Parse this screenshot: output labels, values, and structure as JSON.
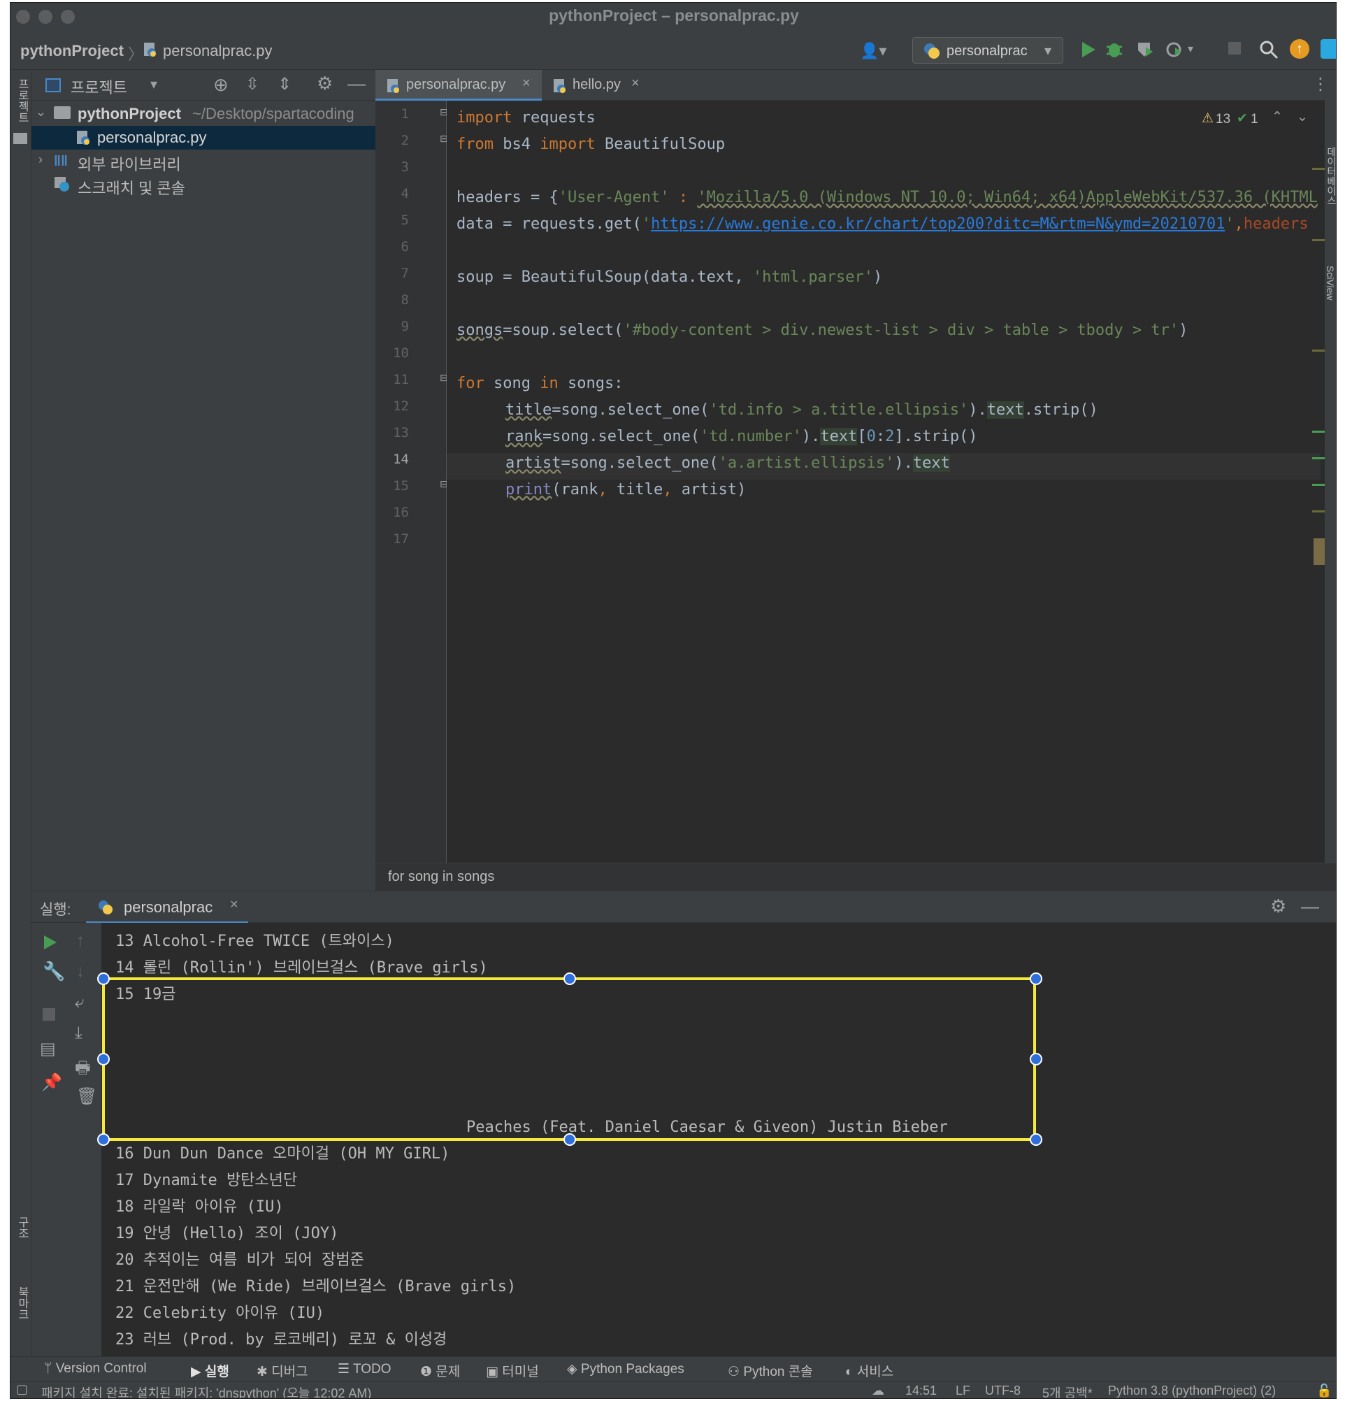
{
  "window": {
    "title": "pythonProject – personalprac.py"
  },
  "navbar": {
    "project": "pythonProject",
    "file": "personalprac.py",
    "run_config": "personalprac"
  },
  "project_panel": {
    "header": "프로젝트",
    "root_name": "pythonProject",
    "root_path": "~/Desktop/spartacoding",
    "file": "personalprac.py",
    "external_libs": "외부 라이브러리",
    "scratches": "스크래치 및 콘솔"
  },
  "editor": {
    "tabs": [
      {
        "label": "personalprac.py"
      },
      {
        "label": "hello.py"
      }
    ],
    "inspections": {
      "warnings": "13",
      "ok": "1"
    },
    "line_numbers": [
      "1",
      "2",
      "3",
      "4",
      "5",
      "6",
      "7",
      "8",
      "9",
      "10",
      "11",
      "12",
      "13",
      "14",
      "15",
      "16",
      "17"
    ],
    "current_line": "14",
    "code": {
      "l1_kw": "import",
      "l1_rest": " requests",
      "l2_kw1": "from",
      "l2_mod": " bs4 ",
      "l2_kw2": "import",
      "l2_rest": " BeautifulSoup",
      "l4_a": "headers = {",
      "l4_s1": "'User-Agent'",
      "l4_b": " : ",
      "l4_s2": "'Mozilla/5.0 (Windows NT 10.0; Win64; x64)AppleWebKit/537.36 (KHTML",
      "l5_a": "data = requests.get(",
      "l5_q1": "'",
      "l5_url": "https://www.genie.co.kr/chart/top200?ditc=M&rtm=N&ymd=20210701",
      "l5_q2": "'",
      "l5_b": ",",
      "l5_pm": "headers",
      "l7_a": "soup = BeautifulSoup(data.text, ",
      "l7_s": "'html.parser'",
      "l7_b": ")",
      "l9_a": "songs",
      "l9_b": "=soup.select(",
      "l9_s": "'#body-content > div.newest-list > div > table > tbody > tr'",
      "l9_c": ")",
      "l11_kw1": "for",
      "l11_a": " song ",
      "l11_kw2": "in",
      "l11_b": " songs:",
      "l12_a": "title",
      "l12_b": "=song.select_one(",
      "l12_s": "'td.info > a.title.ellipsis'",
      "l12_c": ").",
      "l12_h": "text",
      "l12_d": ".strip()",
      "l13_a": "rank",
      "l13_b": "=song.select_one(",
      "l13_s": "'td.number'",
      "l13_c": ").",
      "l13_h": "text",
      "l13_d": "[",
      "l13_n1": "0",
      "l13_e": ":",
      "l13_n2": "2",
      "l13_f": "].strip()",
      "l14_a": "artist",
      "l14_b": "=song.select_one(",
      "l14_s": "'a.artist.ellipsis'",
      "l14_c": ").",
      "l14_h": "text",
      "l15_bi": "print",
      "l15_a": "(rank",
      "l15_c1": ",",
      "l15_b": " title",
      "l15_c2": ",",
      "l15_d": " artist)"
    },
    "breadcrumb": "for song in songs"
  },
  "run_panel": {
    "label": "실행:",
    "tab": "personalprac",
    "output": [
      "13 Alcohol-Free TWICE (트와이스)",
      "14 롤린 (Rollin') 브레이브걸스 (Brave girls)",
      "15 19금",
      "Peaches (Feat. Daniel Caesar & Giveon) Justin Bieber",
      "16 Dun Dun Dance 오마이걸 (OH MY GIRL)",
      "17 Dynamite 방탄소년단",
      "18 라일락 아이유 (IU)",
      "19 안녕 (Hello) 조이 (JOY)",
      "20 추적이는 여름 비가 되어 장범준",
      "21 운전만해 (We Ride) 브레이브걸스 (Brave girls)",
      "22 Celebrity 아이유 (IU)",
      "23 러브 (Prod. by 로코베리) 로꼬 & 이성경"
    ]
  },
  "bottom_tabs": [
    "Version Control",
    "실행",
    "디버그",
    "TODO",
    "문제",
    "터미널",
    "Python Packages",
    "Python 콘솔",
    "서비스"
  ],
  "status": {
    "message": "패키지 설치 완료: 설치된 패키지: 'dnspython' (오늘 12:02 AM)",
    "position": "14:51",
    "line_sep": "LF",
    "encoding": "UTF-8",
    "indent": "5개 공백*",
    "interpreter": "Python 3.8 (pythonProject) (2)"
  },
  "side_labels": {
    "project": "프로젝트",
    "structure": "구조",
    "bookmarks": "북마크",
    "database": "데이터베이스",
    "sciview": "SciView"
  },
  "colors": {
    "accent_blue": "#4a88c7",
    "selection_yellow": "#f5ea3b",
    "run_green": "#499c54",
    "keyword": "#cc7832",
    "string": "#6a8759"
  }
}
